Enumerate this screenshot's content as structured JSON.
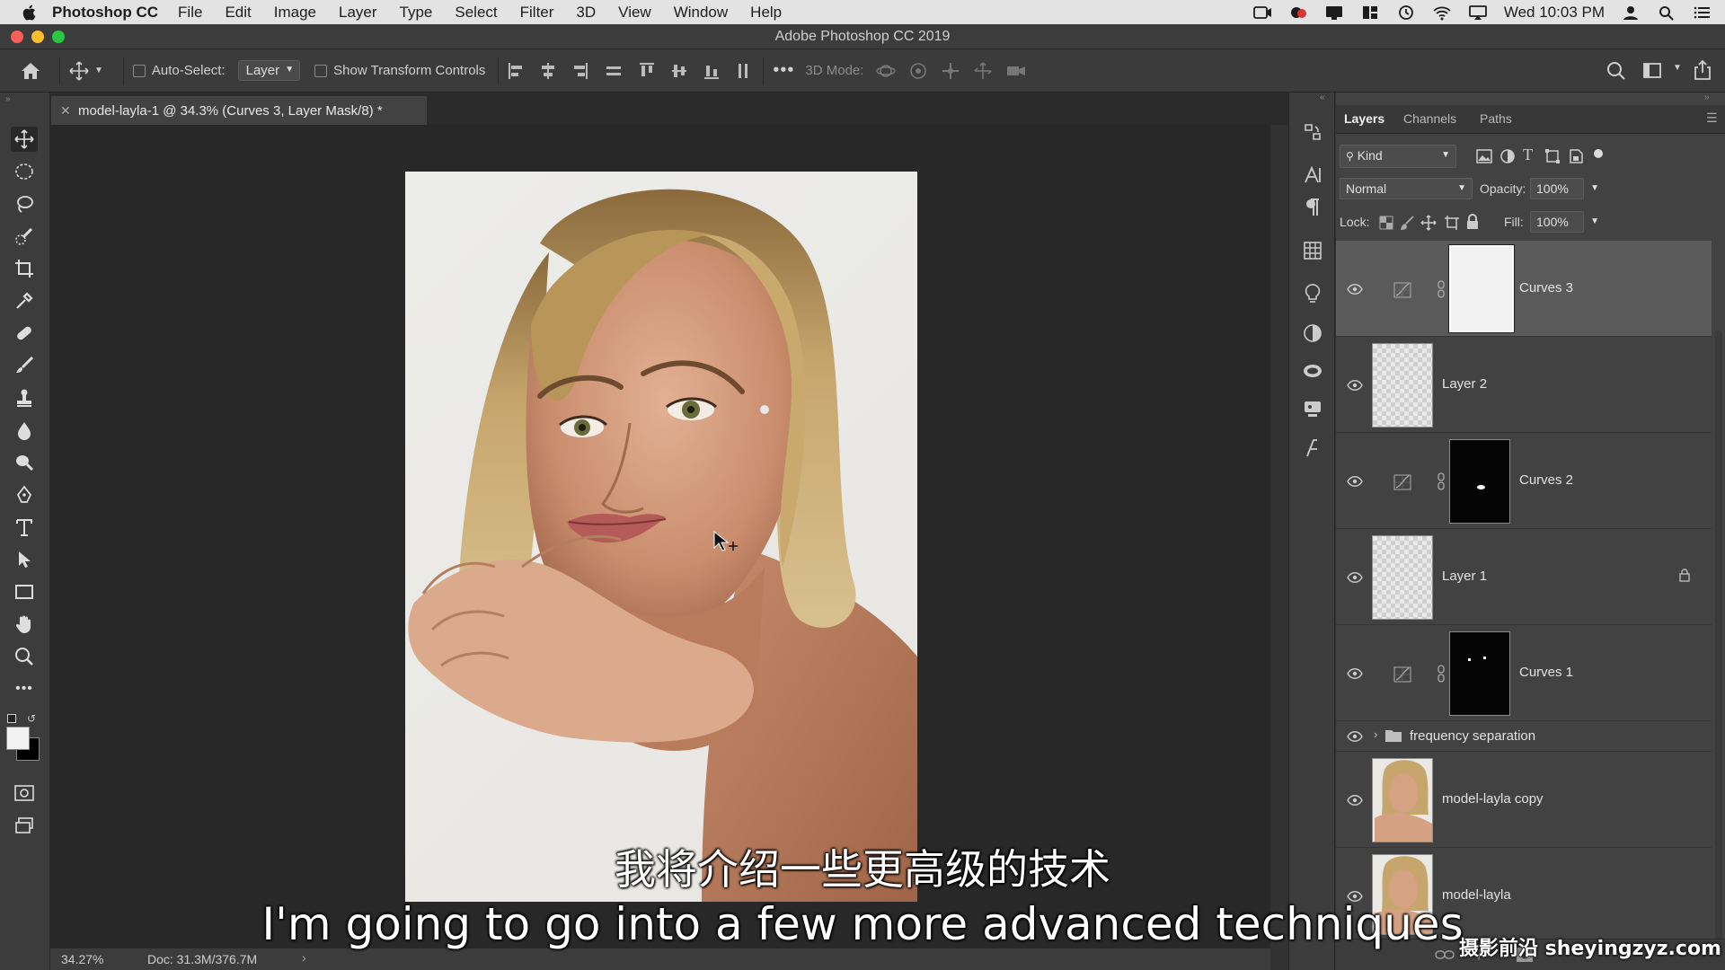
{
  "menubar": {
    "app_name": "Photoshop CC",
    "items": [
      "File",
      "Edit",
      "Image",
      "Layer",
      "Type",
      "Select",
      "Filter",
      "3D",
      "View",
      "Window",
      "Help"
    ],
    "clock": "Wed 10:03 PM"
  },
  "window": {
    "title": "Adobe Photoshop CC 2019"
  },
  "options_bar": {
    "auto_select_label": "Auto-Select:",
    "auto_select_value": "Layer",
    "show_transform_label": "Show Transform Controls",
    "mode_3d_label": "3D Mode:"
  },
  "document": {
    "tab_title": "model-layla-1 @ 34.3% (Curves 3, Layer Mask/8) *",
    "zoom": "34.27%",
    "doc_size": "Doc: 31.3M/376.7M"
  },
  "layers_panel": {
    "tabs": [
      "Layers",
      "Channels",
      "Paths"
    ],
    "filter_kind": "Kind",
    "blend_mode": "Normal",
    "opacity_label": "Opacity:",
    "opacity_value": "100%",
    "lock_label": "Lock:",
    "fill_label": "Fill:",
    "fill_value": "100%",
    "layers": [
      {
        "name": "Curves 3",
        "type": "adjustment",
        "mask": "white",
        "selected": true
      },
      {
        "name": "Layer 2",
        "type": "pixel",
        "thumb": "transparent"
      },
      {
        "name": "Curves 2",
        "type": "adjustment",
        "mask": "black"
      },
      {
        "name": "Layer 1",
        "type": "pixel",
        "thumb": "transparent",
        "locked": true
      },
      {
        "name": "Curves 1",
        "type": "adjustment",
        "mask": "black"
      },
      {
        "name": "frequency separation",
        "type": "group"
      },
      {
        "name": "model-layla copy",
        "type": "photo"
      },
      {
        "name": "model-layla",
        "type": "photo"
      }
    ]
  },
  "subtitles": {
    "chinese": "我将介绍一些更高级的技术",
    "english": "I'm going to go into a few more advanced techniques"
  },
  "watermark": "摄影前沿 sheyingzyz.com",
  "colors": {
    "panel_bg": "#424242",
    "canvas_bg": "#282828",
    "selected_layer": "#5a5a5a",
    "traffic_red": "#ff5f57",
    "traffic_yellow": "#febc2e",
    "traffic_green": "#28c840"
  }
}
